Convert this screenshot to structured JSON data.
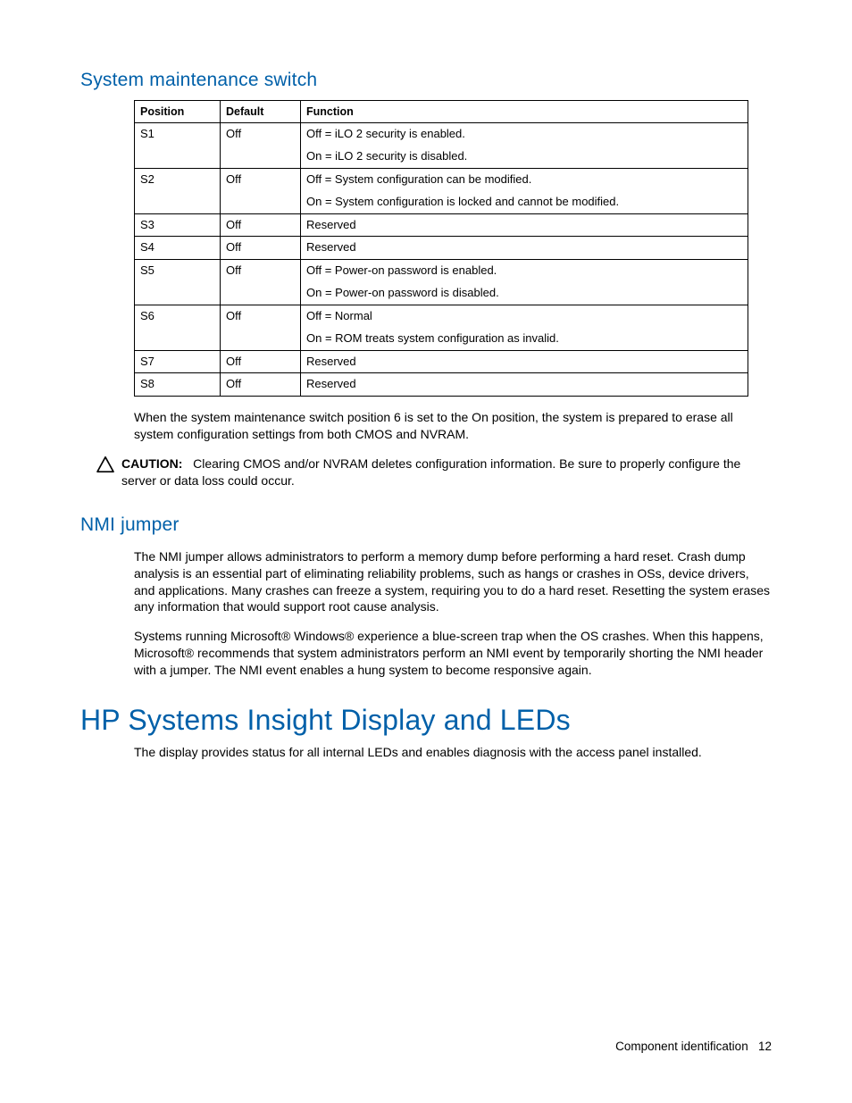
{
  "sections": {
    "sysMaint": {
      "title": "System maintenance switch",
      "table": {
        "headers": {
          "pos": "Position",
          "def": "Default",
          "fn": "Function"
        },
        "rows": [
          {
            "pos": "S1",
            "def": "Off",
            "fn": [
              "Off = iLO 2 security is enabled.",
              "On = iLO 2 security is disabled."
            ]
          },
          {
            "pos": "S2",
            "def": "Off",
            "fn": [
              "Off = System configuration can be modified.",
              "On = System configuration is locked and cannot be modified."
            ]
          },
          {
            "pos": "S3",
            "def": "Off",
            "fn": [
              "Reserved"
            ]
          },
          {
            "pos": "S4",
            "def": "Off",
            "fn": [
              "Reserved"
            ]
          },
          {
            "pos": "S5",
            "def": "Off",
            "fn": [
              "Off = Power-on password is enabled.",
              "On = Power-on password is disabled."
            ]
          },
          {
            "pos": "S6",
            "def": "Off",
            "fn": [
              "Off = Normal",
              "On = ROM treats system configuration as invalid."
            ]
          },
          {
            "pos": "S7",
            "def": "Off",
            "fn": [
              "Reserved"
            ]
          },
          {
            "pos": "S8",
            "def": "Off",
            "fn": [
              "Reserved"
            ]
          }
        ]
      },
      "note": "When the system maintenance switch position 6 is set to the On position, the system is prepared to erase all system configuration settings from both CMOS and NVRAM.",
      "caution": {
        "label": "CAUTION:",
        "text": "Clearing CMOS and/or NVRAM deletes configuration information. Be sure to properly configure the server or data loss could occur."
      }
    },
    "nmi": {
      "title": "NMI jumper",
      "p1": "The NMI jumper allows administrators to perform a memory dump before performing a hard reset. Crash dump analysis is an essential part of eliminating reliability problems, such as hangs or crashes in OSs, device drivers, and applications. Many crashes can freeze a system, requiring you to do a hard reset. Resetting the system erases any information that would support root cause analysis.",
      "p2": "Systems running Microsoft® Windows® experience a blue-screen trap when the OS crashes. When this happens, Microsoft® recommends that system administrators perform an NMI event by temporarily shorting the NMI header with a jumper. The NMI event enables a hung system to become responsive again."
    },
    "insight": {
      "title": "HP Systems Insight Display and LEDs",
      "p1": "The display provides status for all internal LEDs and enables diagnosis with the access panel installed."
    }
  },
  "footer": {
    "section": "Component identification",
    "page": "12"
  }
}
